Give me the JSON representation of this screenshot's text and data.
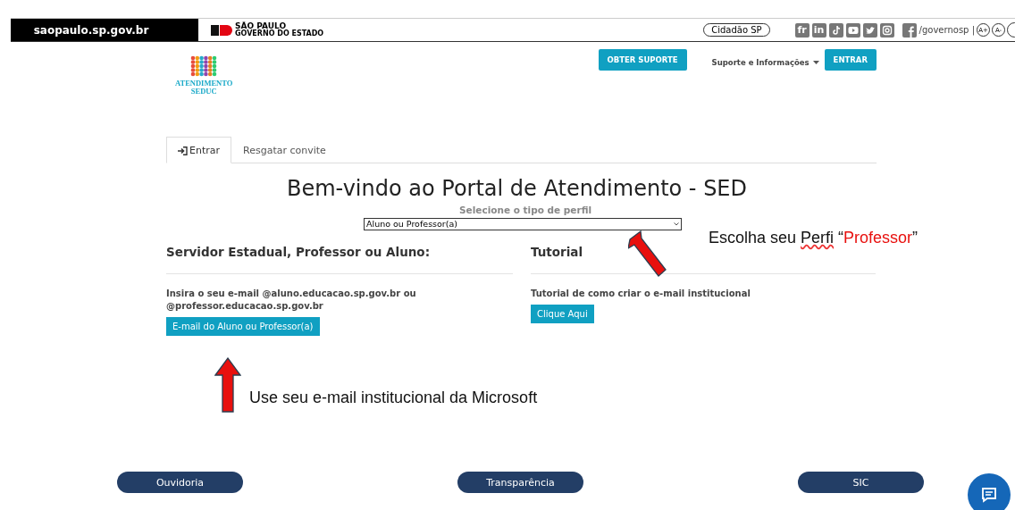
{
  "gov_bar": {
    "site": "saopaulo.sp.gov.br",
    "brand_title": "SÃO PAULO",
    "brand_subtitle": "GOVERNO DO ESTADO",
    "citizen_button": "Cidadão SP",
    "social": [
      {
        "kind": "text",
        "label": "fr"
      },
      {
        "kind": "text",
        "label": "in"
      },
      {
        "kind": "tiktok"
      },
      {
        "kind": "youtube"
      },
      {
        "kind": "twitter"
      },
      {
        "kind": "instagram"
      },
      {
        "kind": "facebook"
      }
    ],
    "handle": "/governosp |",
    "font_buttons": [
      "A+",
      "A-"
    ]
  },
  "header": {
    "logo_lines": [
      "ATENDIMENTO",
      "SEDUC"
    ],
    "support_button": "OBTER SUPORTE",
    "info_menu": "Suporte e Informações",
    "login_button": "ENTRAR"
  },
  "tabs": [
    {
      "label": "Entrar",
      "selected": true,
      "icon": true
    },
    {
      "label": "Resgatar convite",
      "selected": false,
      "icon": false
    }
  ],
  "main": {
    "title": "Bem-vindo ao Portal de Atendimento - SED",
    "profile_label": "Selecione o tipo de perfil",
    "profile_value": "Aluno ou Professor(a)",
    "left": {
      "heading": "Servidor Estadual, Professor ou Aluno:",
      "text_lines": [
        "Insira o seu e-mail @aluno.educacao.sp.gov.br ou",
        "@professor.educacao.sp.gov.br"
      ],
      "button": "E-mail do Aluno ou Professor(a)"
    },
    "right": {
      "heading": "Tutorial",
      "text": "Tutorial de como criar o e-mail institucional",
      "button": "Clique Aqui"
    }
  },
  "annotations": [
    {
      "parts": [
        {
          "kind": "plain",
          "text": "Escolha seu "
        },
        {
          "kind": "misspelled",
          "text": "Perfi"
        },
        {
          "kind": "plain",
          "text": "  “"
        },
        {
          "kind": "highlight",
          "text": "Professor"
        },
        {
          "kind": "plain",
          "text": "”"
        }
      ]
    },
    {
      "parts": [
        {
          "kind": "plain",
          "text": "Use seu e-mail institucional da Microsoft"
        }
      ]
    }
  ],
  "footer": [
    "Ouvidoria",
    "Transparência",
    "SIC"
  ]
}
